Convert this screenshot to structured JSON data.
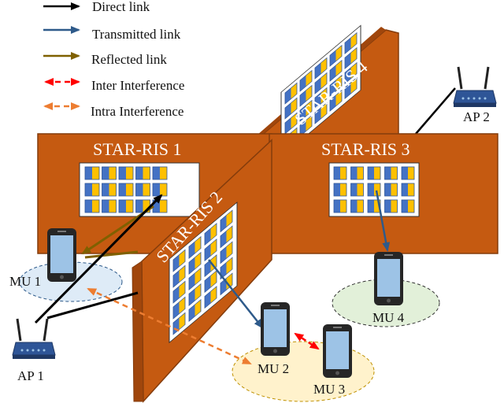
{
  "legend": [
    {
      "label": "Direct link",
      "color": "#000000",
      "style": "solid",
      "heads": "single"
    },
    {
      "label": "Transmitted link",
      "color": "#2e5a8a",
      "style": "solid",
      "heads": "single"
    },
    {
      "label": "Reflected link",
      "color": "#7f6000",
      "style": "solid",
      "heads": "single"
    },
    {
      "label": "Inter Interference",
      "color": "#ff0000",
      "style": "dashed",
      "heads": "double"
    },
    {
      "label": "Intra Interference",
      "color": "#ed7d31",
      "style": "dashed",
      "heads": "double"
    }
  ],
  "walls": {
    "ris1": "STAR-RIS 1",
    "ris2": "STAR-RIS 2",
    "ris3": "STAR-RIS 3",
    "ris4": "STAR-RIS 4"
  },
  "users": {
    "mu1": "MU 1",
    "mu2": "MU 2",
    "mu3": "MU 3",
    "mu4": "MU 4"
  },
  "aps": {
    "ap1": "AP 1",
    "ap2": "AP 2"
  },
  "colors": {
    "wall": "#c55a11",
    "wall_edge": "#843c0c",
    "element_blue": "#4472c4",
    "element_yellow": "#ffc000"
  }
}
